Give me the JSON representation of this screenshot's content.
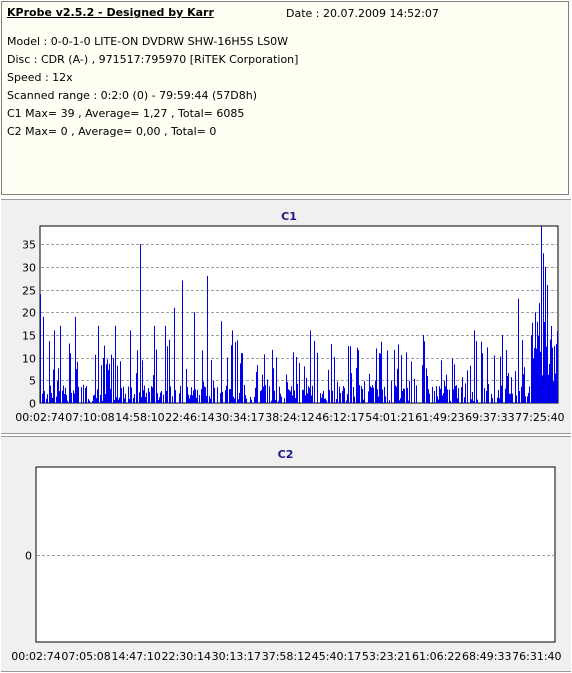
{
  "header": {
    "app_title": "KProbe v2.5.2 - Designed by Karr",
    "date": "Date : 20.07.2009 14:52:07",
    "lines": [
      "Model : 0-0-1-0 LITE-ON DVDRW SHW-16H5S  LS0W",
      "Disc : CDR (A-) , 971517:795970 [RiTEK Corporation]",
      "Speed : 12x",
      "Scanned range : 0:2:0 (0) - 79:59:44 (57D8h)",
      "C1 Max= 39 , Average= 1,27 , Total= 6085",
      "C2 Max= 0 , Average= 0,00 , Total= 0"
    ]
  },
  "colors": {
    "bar": "#0000ee",
    "plot_bg": "#ffffff",
    "grid": "#a0a0a0",
    "title": "#1a1a8c"
  },
  "chart_data": [
    {
      "type": "bar",
      "title": "C1",
      "ylim": [
        0,
        39
      ],
      "yticks": [
        0,
        5,
        10,
        15,
        20,
        25,
        30,
        35
      ],
      "xlim": [
        2,
        4799
      ],
      "xtick_labels": [
        "00:02:74",
        "07:10:08",
        "14:58:10",
        "22:46:14",
        "30:34:17",
        "38:24:12",
        "46:12:17",
        "54:01:21",
        "61:49:23",
        "69:37:33",
        "77:25:40"
      ],
      "grid": "horizontal dashed",
      "spikes": [
        {
          "x": 2,
          "y": 24
        },
        {
          "x": 30,
          "y": 19
        },
        {
          "x": 130,
          "y": 16
        },
        {
          "x": 190,
          "y": 17
        },
        {
          "x": 330,
          "y": 19
        },
        {
          "x": 540,
          "y": 17
        },
        {
          "x": 700,
          "y": 17
        },
        {
          "x": 840,
          "y": 16
        },
        {
          "x": 930,
          "y": 35
        },
        {
          "x": 1060,
          "y": 17
        },
        {
          "x": 1160,
          "y": 17
        },
        {
          "x": 1240,
          "y": 21
        },
        {
          "x": 1320,
          "y": 27
        },
        {
          "x": 1430,
          "y": 20
        },
        {
          "x": 1550,
          "y": 28
        },
        {
          "x": 1680,
          "y": 18
        },
        {
          "x": 1780,
          "y": 16
        },
        {
          "x": 2500,
          "y": 16
        },
        {
          "x": 3110,
          "y": 12
        },
        {
          "x": 3550,
          "y": 15
        },
        {
          "x": 4020,
          "y": 16
        },
        {
          "x": 4280,
          "y": 15
        },
        {
          "x": 4430,
          "y": 23
        },
        {
          "x": 4590,
          "y": 20
        },
        {
          "x": 4620,
          "y": 22
        },
        {
          "x": 4640,
          "y": 39
        },
        {
          "x": 4660,
          "y": 33
        },
        {
          "x": 4680,
          "y": 30
        },
        {
          "x": 4700,
          "y": 26
        },
        {
          "x": 4730,
          "y": 17
        },
        {
          "x": 4760,
          "y": 12
        },
        {
          "x": 4790,
          "y": 10
        }
      ],
      "tail": {
        "from": 4550,
        "to": 4799,
        "min": 4,
        "max": 18
      },
      "body": {
        "typical_max": 12,
        "seed": 7
      }
    },
    {
      "type": "bar",
      "title": "C2",
      "ylim": [
        -1,
        1
      ],
      "yticks": [
        0
      ],
      "xlim": [
        2,
        4799
      ],
      "xtick_labels": [
        "00:02:74",
        "07:05:08",
        "14:47:10",
        "22:30:14",
        "30:13:17",
        "37:58:12",
        "45:40:17",
        "53:23:21",
        "61:06:22",
        "68:49:33",
        "76:31:40"
      ],
      "grid": "horizontal dashed",
      "values": []
    }
  ]
}
